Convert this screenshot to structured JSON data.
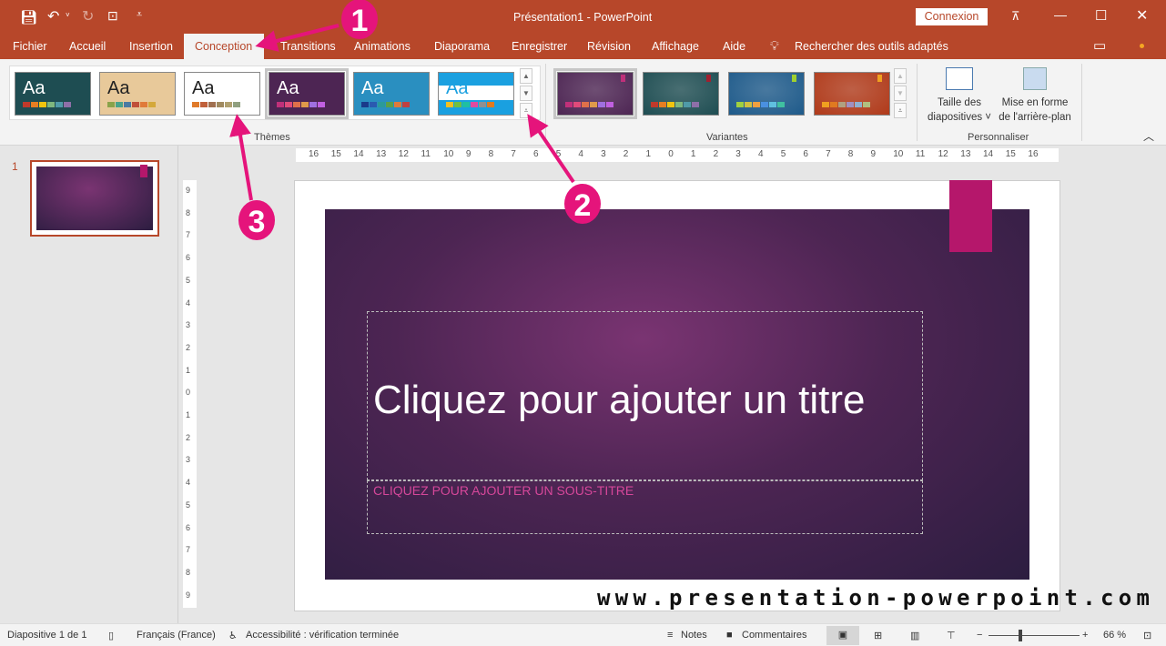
{
  "titlebar": {
    "title": "Présentation1  -  PowerPoint",
    "signin": "Connexion",
    "icons": [
      "save-icon",
      "undo-icon",
      "redo-icon",
      "start-from-beginning-icon",
      "customize-qat-icon",
      "ribbon-display-icon",
      "minimize-icon",
      "maximize-icon",
      "close-icon"
    ]
  },
  "tabs": [
    {
      "label": "Fichier"
    },
    {
      "label": "Accueil"
    },
    {
      "label": "Insertion"
    },
    {
      "label": "Conception"
    },
    {
      "label": "Transitions"
    },
    {
      "label": "Animations"
    },
    {
      "label": "Diaporama"
    },
    {
      "label": "Enregistrer"
    },
    {
      "label": "Révision"
    },
    {
      "label": "Affichage"
    },
    {
      "label": "Aide"
    }
  ],
  "active_tab": "Conception",
  "search": {
    "label": "Rechercher des outils adaptés"
  },
  "ribbon": {
    "themes_label": "Thèmes",
    "variants_label": "Variantes",
    "customize_label": "Personnaliser",
    "slide_size": "Taille des diapositives",
    "slide_size_l1": "Taille des",
    "slide_size_l2": "diapositives ˅",
    "bg_l1": "Mise en forme",
    "bg_l2": "de l'arrière-plan",
    "themes": [
      {
        "aa": "Aa",
        "bg": "#1e4d52",
        "fg": "#fff",
        "sw": [
          "#c0392b",
          "#e67e22",
          "#f1c40f",
          "#7fb77e",
          "#4f9aa8",
          "#8e6fa8"
        ]
      },
      {
        "aa": "Aa",
        "bg": "#e8c99a",
        "fg": "#222",
        "sw": [
          "#8aa34a",
          "#4aa38a",
          "#4a7aa3",
          "#c0503a",
          "#e07a3a",
          "#d4a83a"
        ]
      },
      {
        "aa": "Aa",
        "bg": "#ffffff",
        "fg": "#222",
        "sw": [
          "#e07a2a",
          "#c0603a",
          "#a07050",
          "#a08a60",
          "#b0a070",
          "#90a080"
        ]
      },
      {
        "aa": "Aa",
        "bg": "#4d2553",
        "fg": "#fff",
        "sw": [
          "#c0307a",
          "#e04a7a",
          "#e0704a",
          "#e09a4a",
          "#a070e0",
          "#c060e0"
        ]
      },
      {
        "aa": "Aa",
        "bg": "#2a8fc0",
        "fg": "#fff",
        "sw": [
          "#1a3a8a",
          "#2a5ab0",
          "#2a9a9a",
          "#5aa04a",
          "#e07a3a",
          "#c04040"
        ]
      },
      {
        "aa": "Aa",
        "bg": "#1aa0e0",
        "fg": "#1aa0e0",
        "sw": [
          "#f0c020",
          "#70c040",
          "#20c0a0",
          "#e04aa0",
          "#909090",
          "#e07a20"
        ]
      }
    ],
    "variants": [
      {
        "bg": "#4d2553",
        "tag": "#c0307a",
        "sw": [
          "#c0307a",
          "#e04a7a",
          "#e0704a",
          "#e09a4a",
          "#a070e0",
          "#c060e0"
        ]
      },
      {
        "bg": "#1e4d52",
        "tag": "#a02030",
        "sw": [
          "#c0392b",
          "#e67e22",
          "#f1c40f",
          "#7fb77e",
          "#4f9aa8",
          "#8e6fa8"
        ]
      },
      {
        "bg": "#1e5a8a",
        "tag": "#a0d030",
        "sw": [
          "#a0d040",
          "#d0c040",
          "#f0a040",
          "#4a90e0",
          "#60c0e0",
          "#40c0a0"
        ]
      },
      {
        "bg": "#b03a1a",
        "tag": "#f0a020",
        "sw": [
          "#f0a020",
          "#e07a20",
          "#b0a080",
          "#a090c0",
          "#90b0d0",
          "#b0c080"
        ]
      }
    ]
  },
  "slides_panel": {
    "number": "1"
  },
  "ruler": {
    "h": [
      "16",
      "15",
      "14",
      "13",
      "12",
      "11",
      "10",
      "9",
      "8",
      "7",
      "6",
      "5",
      "4",
      "3",
      "2",
      "1",
      "0",
      "1",
      "2",
      "3",
      "4",
      "5",
      "6",
      "7",
      "8",
      "9",
      "10",
      "11",
      "12",
      "13",
      "14",
      "15",
      "16"
    ],
    "v": [
      "9",
      "8",
      "7",
      "6",
      "5",
      "4",
      "3",
      "2",
      "1",
      "0",
      "1",
      "2",
      "3",
      "4",
      "5",
      "6",
      "7",
      "8",
      "9"
    ]
  },
  "slide": {
    "title": "Cliquez pour ajouter un titre",
    "subtitle": "CLIQUEZ POUR AJOUTER UN SOUS-TITRE",
    "accent": "#b5176b"
  },
  "status": {
    "slide": "Diapositive 1 de 1",
    "language": "Français (France)",
    "accessibility": "Accessibilité : vérification terminée",
    "notes": "Notes",
    "comments": "Commentaires",
    "zoom": "66 %",
    "zoom_percent": 66
  },
  "annotations": {
    "color": "#e5147b",
    "labels": [
      "1",
      "2",
      "3"
    ]
  },
  "watermark": "www.presentation-powerpoint.com"
}
